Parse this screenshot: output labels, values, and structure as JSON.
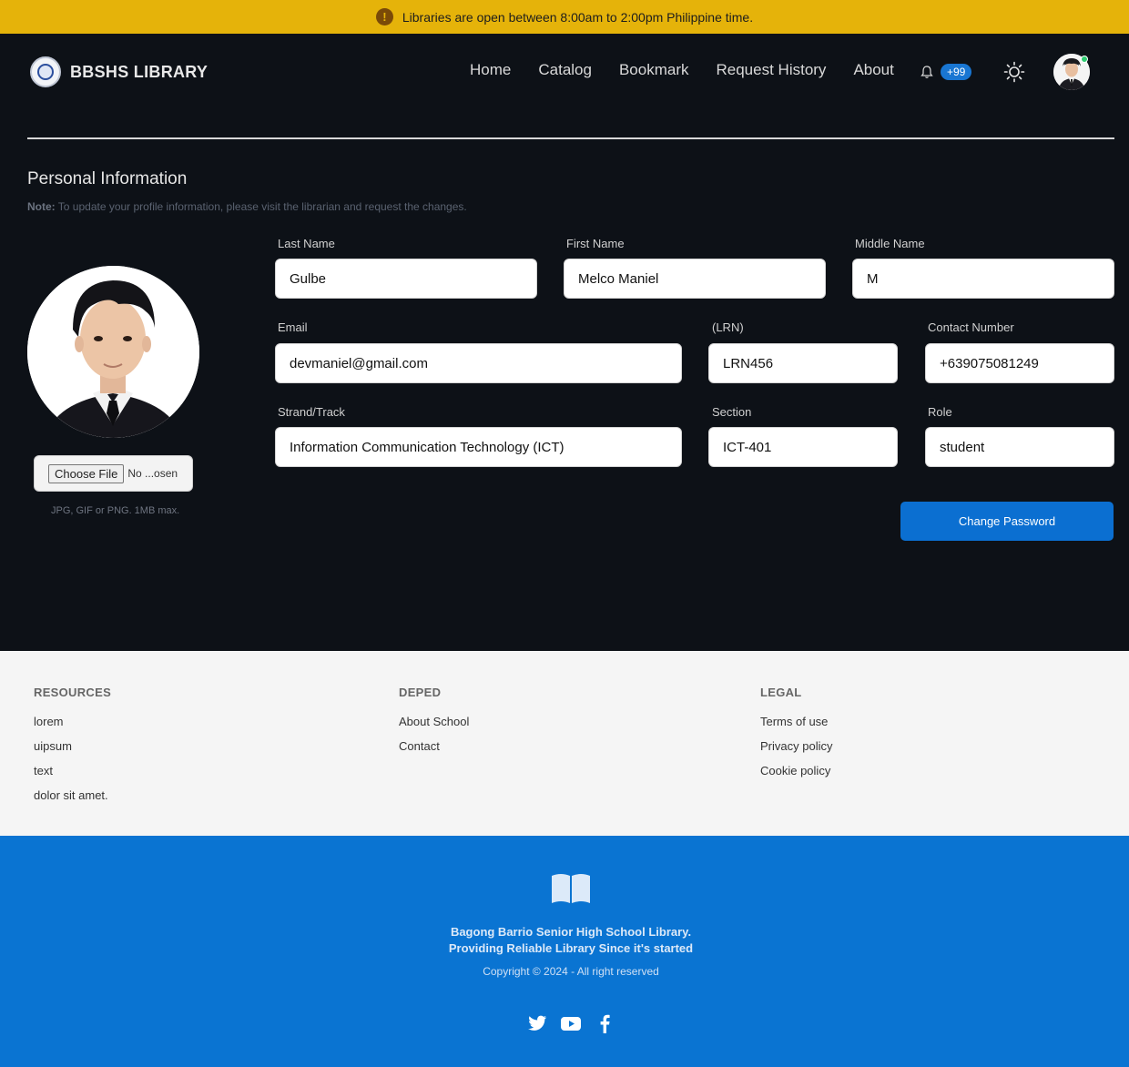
{
  "announcement": {
    "text": "Libraries are open between 8:00am to 2:00pm Philippine time.",
    "icon": "exclamation-icon"
  },
  "brand": {
    "name": "BBSHS LIBRARY"
  },
  "nav": {
    "items": [
      "Home",
      "Catalog",
      "Bookmark",
      "Request History",
      "About"
    ],
    "notif_badge": "+99"
  },
  "page": {
    "title": "Personal Information",
    "note_label": "Note:",
    "note_text": " To update your profile information, please visit the librarian and request the changes."
  },
  "upload": {
    "button": "Choose File",
    "status": "No ...osen",
    "hint": "JPG, GIF or PNG. 1MB max."
  },
  "form": {
    "last_name": {
      "label": "Last Name",
      "value": "Gulbe"
    },
    "first_name": {
      "label": "First Name",
      "value": "Melco Maniel"
    },
    "middle_name": {
      "label": "Middle Name",
      "value": "M"
    },
    "email": {
      "label": "Email",
      "value": "devmaniel@gmail.com"
    },
    "lrn": {
      "label": "(LRN)",
      "value": "LRN456"
    },
    "contact": {
      "label": "Contact Number",
      "value": "+639075081249"
    },
    "strand": {
      "label": "Strand/Track",
      "value": "Information Communication Technology (ICT)"
    },
    "section": {
      "label": "Section",
      "value": "ICT-401"
    },
    "role": {
      "label": "Role",
      "value": "student"
    },
    "change_password": "Change Password"
  },
  "footer": {
    "resources": {
      "heading": "RESOURCES",
      "items": [
        "lorem",
        "uipsum",
        "text",
        "dolor sit amet."
      ]
    },
    "deped": {
      "heading": "DEPED",
      "items": [
        "About School",
        "Contact"
      ]
    },
    "legal": {
      "heading": "LEGAL",
      "items": [
        "Terms of use",
        "Privacy policy",
        "Cookie policy"
      ]
    },
    "line1": "Bagong Barrio Senior High School Library.",
    "line2": "Providing Reliable Library Since it's started",
    "copyright": "Copyright © 2024 - All right reserved"
  },
  "colors": {
    "announce": "#e5b30a",
    "bg": "#0d1117",
    "primary": "#0b6fd1",
    "footer_blue": "#0a74d2"
  }
}
